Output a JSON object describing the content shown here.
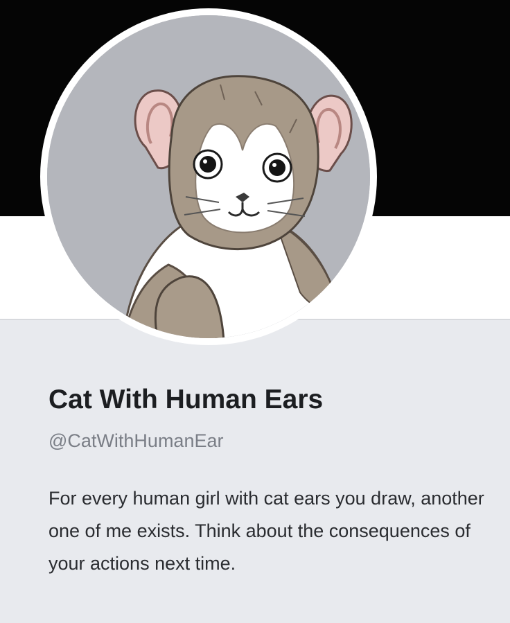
{
  "profile": {
    "display_name": "Cat With Human Ears",
    "handle": "@CatWithHumanEar",
    "bio": "For every human girl with cat ears you draw, another one of me exists. Think about the consequences of your actions next time."
  },
  "avatar": {
    "icon": "cat-with-human-ears-avatar-icon",
    "background_color": "#b4b6bc",
    "fur_color": "#a79988",
    "ear_color": "#ecc9c6"
  },
  "colors": {
    "banner": "#050505",
    "card_background": "#e8eaee",
    "name_text": "#1c1e21",
    "handle_text": "#7a7e86"
  }
}
